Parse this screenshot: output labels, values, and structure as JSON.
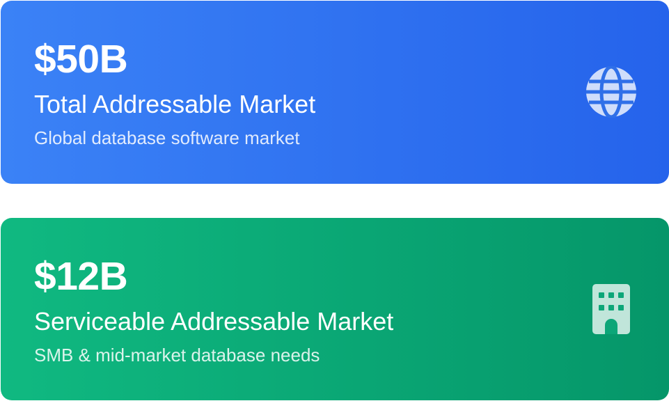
{
  "cards": [
    {
      "value": "$50B",
      "title": "Total Addressable Market",
      "subtitle": "Global database software market",
      "icon": "globe-icon",
      "color_start": "#3b82f6",
      "color_end": "#2563eb"
    },
    {
      "value": "$12B",
      "title": "Serviceable Addressable Market",
      "subtitle": "SMB & mid-market database needs",
      "icon": "building-icon",
      "color_start": "#10b981",
      "color_end": "#059669"
    }
  ]
}
